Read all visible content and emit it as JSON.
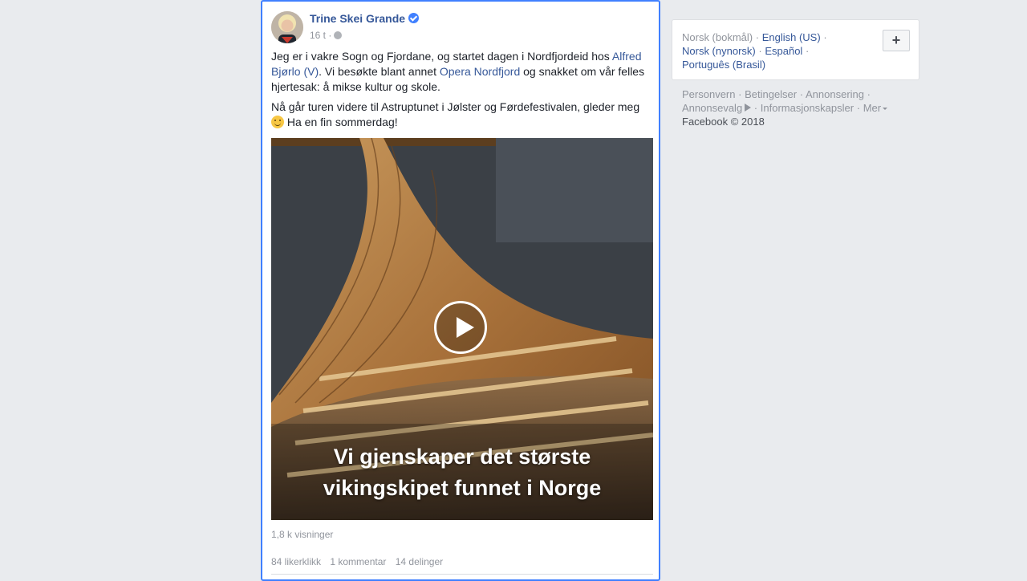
{
  "post": {
    "author": "Trine Skei Grande",
    "time": "16 t",
    "meta_separator": "·",
    "text": {
      "p1_a": "Jeg er i vakre Sogn og Fjordane, og startet dagen i Nordfjordeid hos ",
      "p1_link1": "Alfred Bjørlo (V)",
      "p1_b": ". Vi besøkte blant annet ",
      "p1_link2": "Opera Nordfjord",
      "p1_c": " og snakket om vår felles hjertesak: å mikse kultur og skole.",
      "p2_a": "Nå går turen videre til Astruptunet i Jølster og Førdefestivalen, gleder meg ",
      "p2_b": " Ha en fin sommerdag!"
    },
    "video": {
      "caption_line1": "Vi gjenskaper det største",
      "caption_line2": "vikingskipet funnet i Norge"
    },
    "views": "1,8 k visninger",
    "stats": {
      "likes": "84 likerklikk",
      "comments": "1 kommentar",
      "shares": "14 delinger"
    }
  },
  "languages": {
    "current": "Norsk (bokmål)",
    "sep": "·",
    "options": [
      "English (US)",
      "Norsk (nynorsk)",
      "Español",
      "Português (Brasil)"
    ],
    "add_label": "+"
  },
  "footer": {
    "links": [
      "Personvern",
      "Betingelser",
      "Annonsering",
      "Annonsevalg",
      "Informasjonskapsler",
      "Mer"
    ],
    "sep": "·",
    "copyright": "Facebook © 2018"
  }
}
